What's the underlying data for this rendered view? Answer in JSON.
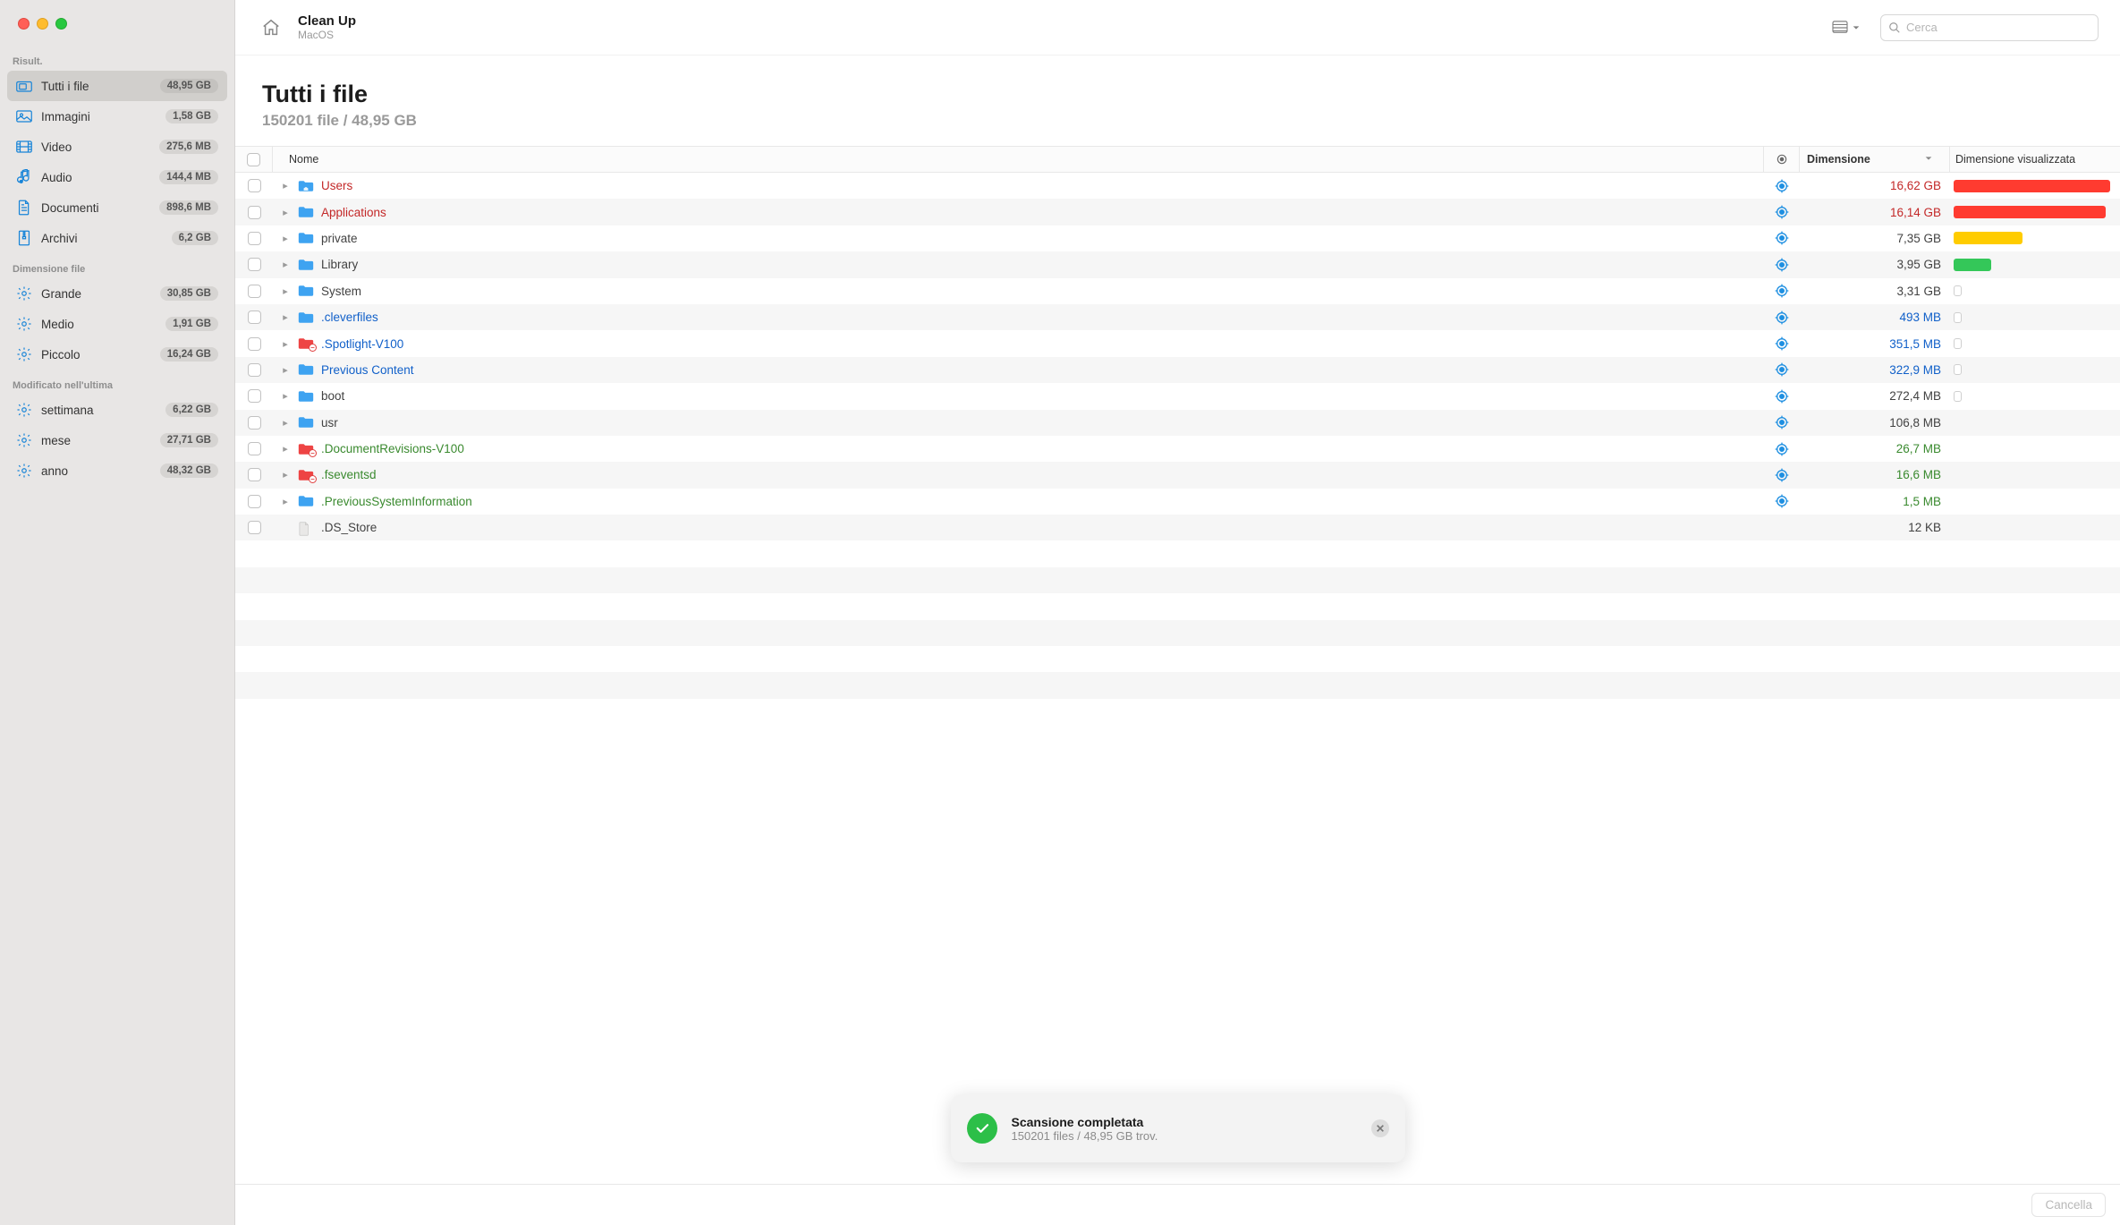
{
  "header": {
    "title": "Clean Up",
    "subtitle": "MacOS",
    "search_placeholder": "Cerca"
  },
  "page": {
    "title": "Tutti i file",
    "subtitle": "150201 file / 48,95 GB"
  },
  "sidebar": {
    "sections": [
      {
        "label": "Risult.",
        "items": [
          {
            "icon": "files-icon",
            "label": "Tutti i file",
            "badge": "48,95 GB",
            "active": true,
            "icon_color": "#1784d8"
          },
          {
            "icon": "image-icon",
            "label": "Immagini",
            "badge": "1,58 GB",
            "icon_color": "#1784d8"
          },
          {
            "icon": "video-icon",
            "label": "Video",
            "badge": "275,6 MB",
            "icon_color": "#1784d8"
          },
          {
            "icon": "audio-icon",
            "label": "Audio",
            "badge": "144,4 MB",
            "icon_color": "#1784d8"
          },
          {
            "icon": "document-icon",
            "label": "Documenti",
            "badge": "898,6 MB",
            "icon_color": "#1784d8"
          },
          {
            "icon": "archive-icon",
            "label": "Archivi",
            "badge": "6,2 GB",
            "icon_color": "#1784d8"
          }
        ]
      },
      {
        "label": "Dimensione file",
        "items": [
          {
            "icon": "gear-icon",
            "label": "Grande",
            "badge": "30,85 GB",
            "icon_color": "#1784d8"
          },
          {
            "icon": "gear-icon",
            "label": "Medio",
            "badge": "1,91 GB",
            "icon_color": "#1784d8"
          },
          {
            "icon": "gear-icon",
            "label": "Piccolo",
            "badge": "16,24 GB",
            "icon_color": "#1784d8"
          }
        ]
      },
      {
        "label": "Modificato nell'ultima",
        "items": [
          {
            "icon": "gear-icon",
            "label": "settimana",
            "badge": "6,22 GB",
            "icon_color": "#1784d8"
          },
          {
            "icon": "gear-icon",
            "label": "mese",
            "badge": "27,71 GB",
            "icon_color": "#1784d8"
          },
          {
            "icon": "gear-icon",
            "label": "anno",
            "badge": "48,32 GB",
            "icon_color": "#1784d8"
          }
        ]
      }
    ]
  },
  "columns": {
    "name": "Nome",
    "size": "Dimensione",
    "bar": "Dimensione visualizzata"
  },
  "rows": [
    {
      "name": "Users",
      "size": "16,62 GB",
      "color": "#c32828",
      "bar_color": "#ff3b30",
      "bar_pct": 100,
      "folder": "blue-home",
      "has_children": true,
      "targeted": true
    },
    {
      "name": "Applications",
      "size": "16,14 GB",
      "color": "#c32828",
      "bar_color": "#ff3b30",
      "bar_pct": 97,
      "folder": "blue",
      "has_children": true,
      "targeted": true
    },
    {
      "name": "private",
      "size": "7,35 GB",
      "color": "#424242",
      "bar_color": "#ffcc00",
      "bar_pct": 44,
      "folder": "blue",
      "has_children": true,
      "targeted": true
    },
    {
      "name": "Library",
      "size": "3,95 GB",
      "color": "#424242",
      "bar_color": "#34c759",
      "bar_pct": 24,
      "folder": "blue",
      "has_children": true,
      "targeted": true
    },
    {
      "name": "System",
      "size": "3,31 GB",
      "color": "#424242",
      "bar_color": "none",
      "bar_pct": 20,
      "bar_outline": true,
      "folder": "blue",
      "has_children": true,
      "targeted": true
    },
    {
      "name": ".cleverfiles",
      "size": "493 MB",
      "color": "#1160c9",
      "bar_color": "none",
      "bar_pct": 3,
      "bar_outline": true,
      "folder": "blue",
      "has_children": true,
      "targeted": true
    },
    {
      "name": ".Spotlight-V100",
      "size": "351,5 MB",
      "color": "#1160c9",
      "bar_color": "none",
      "bar_pct": 2,
      "bar_outline": true,
      "folder": "red-locked",
      "has_children": true,
      "targeted": true
    },
    {
      "name": "Previous Content",
      "size": "322,9 MB",
      "color": "#1160c9",
      "bar_color": "none",
      "bar_pct": 2,
      "bar_outline": true,
      "folder": "blue",
      "has_children": true,
      "targeted": true
    },
    {
      "name": "boot",
      "size": "272,4 MB",
      "color": "#424242",
      "bar_color": "none",
      "bar_pct": 2,
      "bar_outline": true,
      "folder": "blue",
      "has_children": true,
      "targeted": true
    },
    {
      "name": "usr",
      "size": "106,8 MB",
      "color": "#424242",
      "bar_color": "none",
      "bar_pct": 0,
      "folder": "blue",
      "has_children": true,
      "targeted": true
    },
    {
      "name": ".DocumentRevisions-V100",
      "size": "26,7 MB",
      "color": "#3a8a2f",
      "bar_color": "none",
      "bar_pct": 0,
      "folder": "red-locked",
      "has_children": true,
      "targeted": true
    },
    {
      "name": ".fseventsd",
      "size": "16,6 MB",
      "color": "#3a8a2f",
      "bar_color": "none",
      "bar_pct": 0,
      "folder": "red-locked",
      "has_children": true,
      "targeted": true
    },
    {
      "name": ".PreviousSystemInformation",
      "size": "1,5 MB",
      "color": "#3a8a2f",
      "bar_color": "none",
      "bar_pct": 0,
      "folder": "blue",
      "has_children": true,
      "targeted": true
    },
    {
      "name": ".DS_Store",
      "size": "12 KB",
      "color": "#424242",
      "bar_color": "none",
      "bar_pct": 0,
      "folder": "file",
      "has_children": false,
      "targeted": false
    }
  ],
  "toast": {
    "title": "Scansione completata",
    "subtitle": "150201 files / 48,95 GB trov."
  },
  "footer": {
    "delete_label": "Cancella"
  }
}
